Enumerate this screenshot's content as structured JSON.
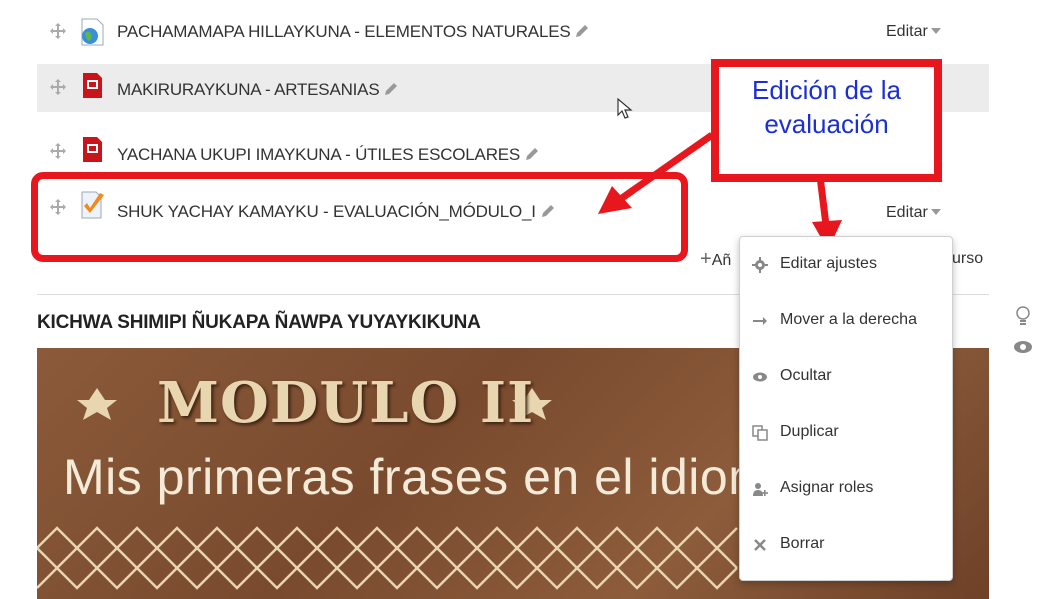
{
  "rows": [
    {
      "title": "PACHAMAMAPA HILLAYKUNA - ELEMENTOS NATURALES",
      "icon": "globe-icon",
      "edit": "Editar"
    },
    {
      "title": "MAKIRURAYKUNA - ARTESANIAS",
      "icon": "pdf-file-icon",
      "edit": ""
    },
    {
      "title": "YACHANA UKUPI IMAYKUNA - ÚTILES ESCOLARES",
      "icon": "pdf-file-icon",
      "edit": ""
    },
    {
      "title": "SHUK YACHAY KAMAYKU - EVALUACIÓN_MÓDULO_I",
      "icon": "quiz-checkmark-icon",
      "edit": "Editar"
    }
  ],
  "add_activity_partial_left": "Añ",
  "add_activity_partial_right": "urso",
  "callout": {
    "line1": "Edición de la",
    "line2": "evaluación"
  },
  "menu": [
    {
      "label": "Editar ajustes",
      "icon": "gear-icon"
    },
    {
      "label": "Mover a la derecha",
      "icon": "arrow-right-icon"
    },
    {
      "label": "Ocultar",
      "icon": "eye-icon"
    },
    {
      "label": "Duplicar",
      "icon": "duplicate-icon"
    },
    {
      "label": "Asignar roles",
      "icon": "assign-user-icon"
    },
    {
      "label": "Borrar",
      "icon": "delete-x-icon"
    }
  ],
  "section": {
    "title": "KICHWA SHIMIPI ÑUKAPA ÑAWPA YUYAYKIKUNA"
  },
  "banner": {
    "line1": "MODULO II",
    "line2": "Mis primeras frases en el idioma K"
  },
  "colors": {
    "highlight": "#e8171d",
    "callout_text": "#1a2fd6",
    "banner": "#7a4a2e"
  }
}
